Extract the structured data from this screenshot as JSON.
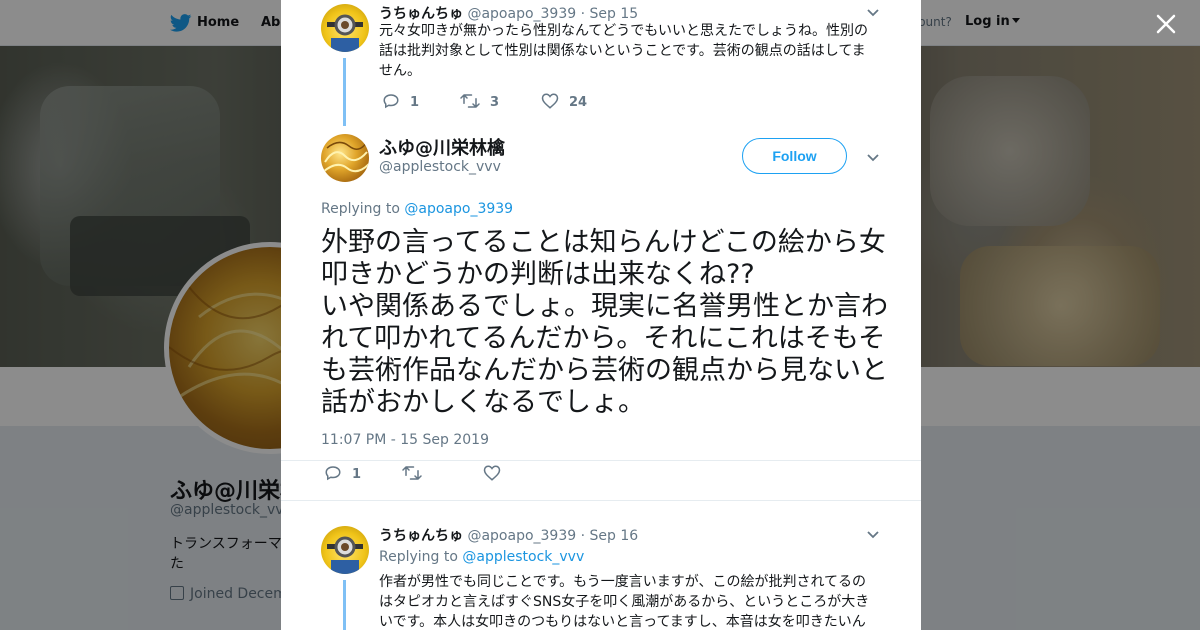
{
  "nav": {
    "home_label": "Home",
    "about_label": "Abo",
    "account_prompt": "ccount?",
    "login_label": "Log in"
  },
  "profile": {
    "name": "ふゆ@川栄林檎",
    "handle": "@applestock_vvv",
    "bio": "トランスフォーマ\nた",
    "joined": "Joined Decem"
  },
  "modal": {
    "parent_tweet": {
      "name": "うちゅんちゅ",
      "handle": "@apoapo_3939",
      "date": "Sep 15",
      "text": "元々女叩きが無かったら性別なんてどうでもいいと思えたでしょうね。性別の話は批判対象として性別は関係ないということです。芸術の観点の話はしてません。",
      "replies": "1",
      "retweets": "3",
      "likes": "24"
    },
    "main_tweet": {
      "name": "ふゆ@川栄林檎",
      "handle": "@applestock_vvv",
      "follow_label": "Follow",
      "replying_prefix": "Replying to",
      "replying_to": "@apoapo_3939",
      "text": "外野の言ってることは知らんけどこの絵から女叩きかどうかの判断は出来なくね??\nいや関係あるでしょ。現実に名誉男性とか言われて叩かれてるんだから。それにこれはそもそも芸術作品なんだから芸術の観点から見ないと話がおかしくなるでしょ。",
      "timestamp": "11:07 PM - 15 Sep 2019",
      "replies": "1"
    },
    "reply_tweet": {
      "name": "うちゅんちゅ",
      "handle": "@apoapo_3939",
      "date": "Sep 16",
      "replying_prefix": "Replying to",
      "replying_to": "@applestock_vvv",
      "text": "作者が男性でも同じことです。もう一度言いますが、この絵が批判されてるのはタピオカと言えばすぐSNS女子を叩く風潮があるから、というところが大きいです。本人は女叩きのつもりはないと言ってますし、本音は女を叩きたいん"
    }
  },
  "colors": {
    "accent": "#1da1f2",
    "link": "#1b95e0",
    "muted": "#657786",
    "thread_line": "#7fc0f5"
  },
  "icons": [
    "twitter-bird-icon",
    "close-icon",
    "reply-icon",
    "retweet-icon",
    "like-icon",
    "chevron-down-icon",
    "calendar-icon"
  ]
}
